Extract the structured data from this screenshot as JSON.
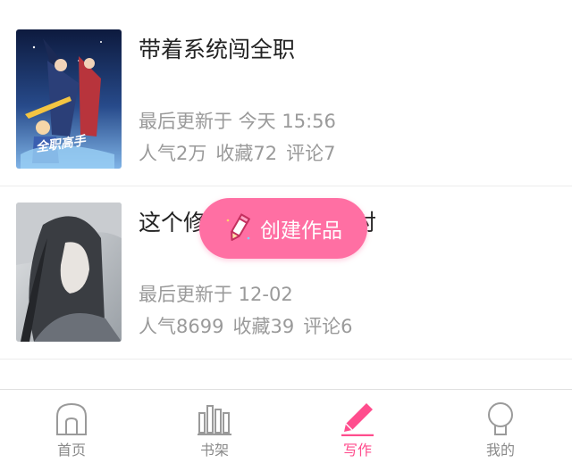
{
  "works": [
    {
      "title": "带着系统闯全职",
      "updated": "最后更新于 今天 15:56",
      "popularity": "人气2万",
      "favorites": "收藏72",
      "comments": "评论7",
      "cover_icon": "anime-cover-image"
    },
    {
      "title": "这个修",
      "title_tail": "对",
      "updated": "最后更新于 12-02",
      "popularity": "人气8699",
      "favorites": "收藏39",
      "comments": "评论6",
      "cover_icon": "portrait-cover-image"
    }
  ],
  "create_button": {
    "label": "创建作品",
    "icon": "pencil-icon"
  },
  "tabbar": {
    "home": "首页",
    "bookshelf": "书架",
    "write": "写作",
    "mine": "我的",
    "active_tab": "write",
    "active_color": "#ff4d8d",
    "inactive_color": "#8a8a8a"
  },
  "colors": {
    "accent": "#ff6fa3",
    "meta_text": "#9a9a9a"
  }
}
